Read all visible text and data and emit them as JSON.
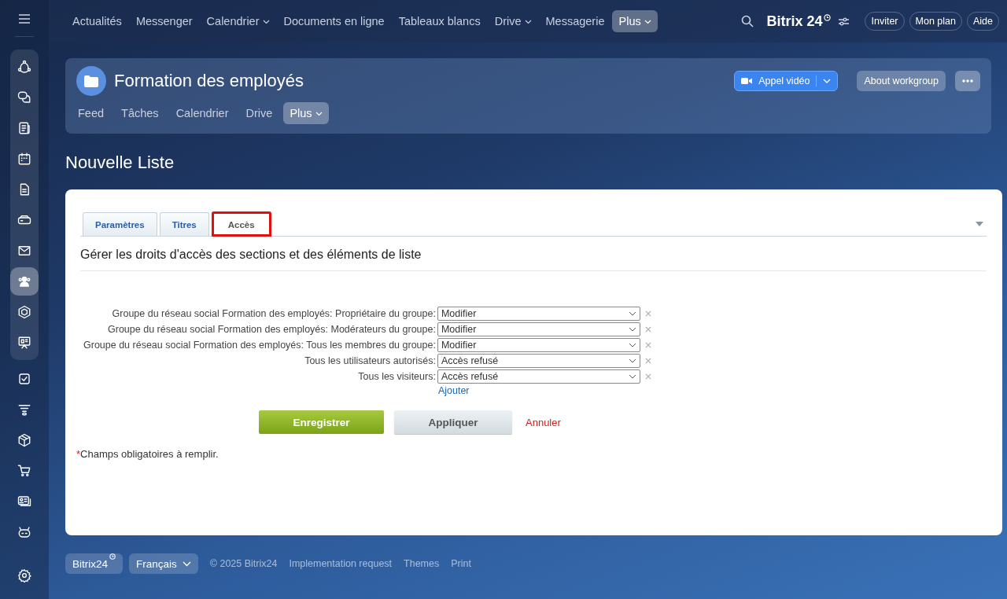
{
  "sidebar": {
    "items": [
      {
        "selected": false
      },
      {
        "selected": false
      },
      {
        "selected": false
      },
      {
        "selected": false
      },
      {
        "selected": false
      },
      {
        "selected": false
      },
      {
        "selected": false
      },
      {
        "selected": true
      },
      {
        "selected": false
      },
      {
        "selected": false
      },
      {
        "selected": false
      },
      {
        "selected": false
      },
      {
        "selected": false
      },
      {
        "selected": false
      },
      {
        "selected": false
      },
      {
        "selected": false
      }
    ]
  },
  "top_nav": {
    "items": [
      {
        "label": "Actualités",
        "dropdown": false,
        "selected": false
      },
      {
        "label": "Messenger",
        "dropdown": false,
        "selected": false
      },
      {
        "label": "Calendrier",
        "dropdown": true,
        "selected": false
      },
      {
        "label": "Documents en ligne",
        "dropdown": false,
        "selected": false
      },
      {
        "label": "Tableaux blancs",
        "dropdown": false,
        "selected": false
      },
      {
        "label": "Drive",
        "dropdown": true,
        "selected": false
      },
      {
        "label": "Messagerie",
        "dropdown": false,
        "selected": false
      },
      {
        "label": "Plus",
        "dropdown": true,
        "selected": true
      }
    ],
    "logo": "Bitrix 24",
    "buttons": [
      "Inviter",
      "Mon plan",
      "Aide"
    ]
  },
  "group": {
    "title": "Formation des employés",
    "video_button": "Appel vidéo",
    "about_button": "About workgroup",
    "tabs": [
      {
        "label": "Feed",
        "dropdown": false,
        "selected": false
      },
      {
        "label": "Tâches",
        "dropdown": false,
        "selected": false
      },
      {
        "label": "Calendrier",
        "dropdown": false,
        "selected": false
      },
      {
        "label": "Drive",
        "dropdown": false,
        "selected": false
      },
      {
        "label": "Plus",
        "dropdown": true,
        "selected": true
      }
    ]
  },
  "page_title": "Nouvelle Liste",
  "form": {
    "tabs": [
      {
        "label": "Paramètres",
        "selected": false,
        "highlighted": false
      },
      {
        "label": "Titres",
        "selected": false,
        "highlighted": false
      },
      {
        "label": "Accès",
        "selected": true,
        "highlighted": true
      }
    ],
    "heading": "Gérer les droits d'accès des sections et des éléments de liste",
    "permissions": [
      {
        "label": "Groupe du réseau social Formation des employés: Propriétaire du groupe:",
        "value": "Modifier"
      },
      {
        "label": "Groupe du réseau social Formation des employés: Modérateurs du groupe:",
        "value": "Modifier"
      },
      {
        "label": "Groupe du réseau social Formation des employés: Tous les membres du groupe:",
        "value": "Modifier"
      },
      {
        "label": "Tous les utilisateurs autorisés:",
        "value": "Accès refusé"
      },
      {
        "label": "Tous les visiteurs:",
        "value": "Accès refusé"
      }
    ],
    "add_link": "Ajouter",
    "save_button": "Enregistrer",
    "apply_button": "Appliquer",
    "cancel_link": "Annuler",
    "required_note": {
      "mark": "*",
      "text": "Champs obligatoires à remplir."
    }
  },
  "footer": {
    "logo": "Bitrix24",
    "language": "Français",
    "links": [
      "© 2025 Bitrix24",
      "Implementation request",
      "Themes",
      "Print"
    ]
  }
}
